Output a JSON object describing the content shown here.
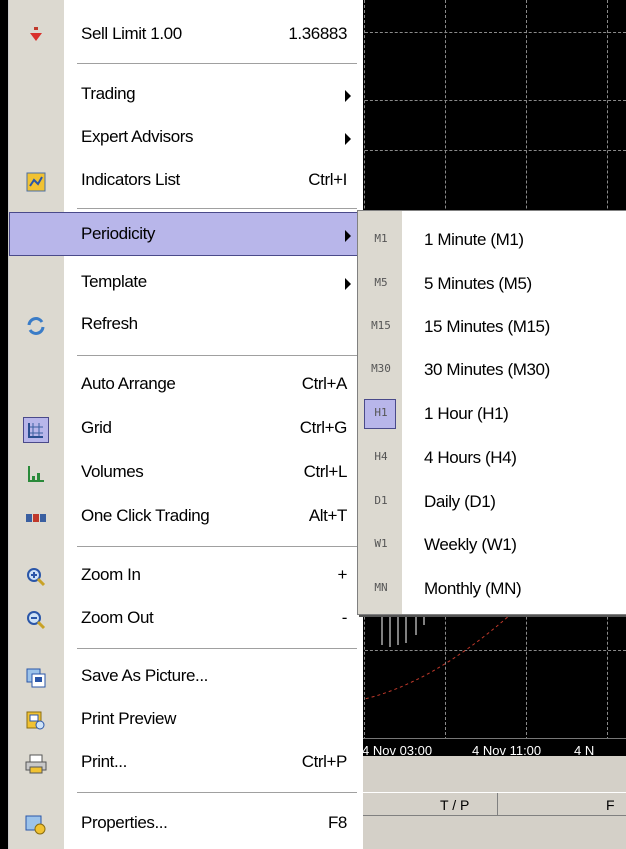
{
  "chart": {
    "time_labels": [
      "4 Nov 03:00",
      "4 Nov 11:00",
      "4 N"
    ],
    "terminal_header": [
      "T / P",
      "F"
    ]
  },
  "menu": {
    "items": [
      {
        "label": "Sell Limit 1.00",
        "shortcut": "1.36883",
        "icon": "sell-limit-icon"
      },
      {
        "label": "Trading",
        "shortcut": "",
        "submenu": true
      },
      {
        "label": "Expert Advisors",
        "shortcut": "",
        "submenu": true
      },
      {
        "label": "Indicators List",
        "shortcut": "Ctrl+I",
        "icon": "indicators-list-icon"
      },
      {
        "label": "Periodicity",
        "shortcut": "",
        "submenu": true,
        "selected": true
      },
      {
        "label": "Template",
        "shortcut": "",
        "submenu": true
      },
      {
        "label": "Refresh",
        "shortcut": "",
        "icon": "refresh-icon"
      },
      {
        "label": "Auto Arrange",
        "shortcut": "Ctrl+A"
      },
      {
        "label": "Grid",
        "shortcut": "Ctrl+G",
        "icon": "grid-icon"
      },
      {
        "label": "Volumes",
        "shortcut": "Ctrl+L",
        "icon": "volumes-icon"
      },
      {
        "label": "One Click Trading",
        "shortcut": "Alt+T",
        "icon": "one-click-trading-icon"
      },
      {
        "label": "Zoom In",
        "shortcut": "+",
        "icon": "zoom-in-icon"
      },
      {
        "label": "Zoom Out",
        "shortcut": "-",
        "icon": "zoom-out-icon"
      },
      {
        "label": "Save As Picture...",
        "shortcut": "",
        "icon": "save-picture-icon"
      },
      {
        "label": "Print Preview",
        "shortcut": "",
        "icon": "print-preview-icon"
      },
      {
        "label": "Print...",
        "shortcut": "Ctrl+P",
        "icon": "print-icon"
      },
      {
        "label": "Properties...",
        "shortcut": "F8",
        "icon": "properties-icon"
      }
    ]
  },
  "periodicity": {
    "items": [
      {
        "code": "M1",
        "label": "1 Minute (M1)"
      },
      {
        "code": "M5",
        "label": "5 Minutes (M5)"
      },
      {
        "code": "M15",
        "label": "15 Minutes (M15)"
      },
      {
        "code": "M30",
        "label": "30 Minutes (M30)"
      },
      {
        "code": "H1",
        "label": "1 Hour (H1)",
        "checked": true
      },
      {
        "code": "H4",
        "label": "4 Hours (H4)"
      },
      {
        "code": "D1",
        "label": "Daily (D1)"
      },
      {
        "code": "W1",
        "label": "Weekly (W1)"
      },
      {
        "code": "MN",
        "label": "Monthly (MN)"
      }
    ]
  },
  "colors": {
    "highlight": "#b8b6ea",
    "icon_column": "#dcd9d0",
    "chart_bg": "#000000"
  }
}
